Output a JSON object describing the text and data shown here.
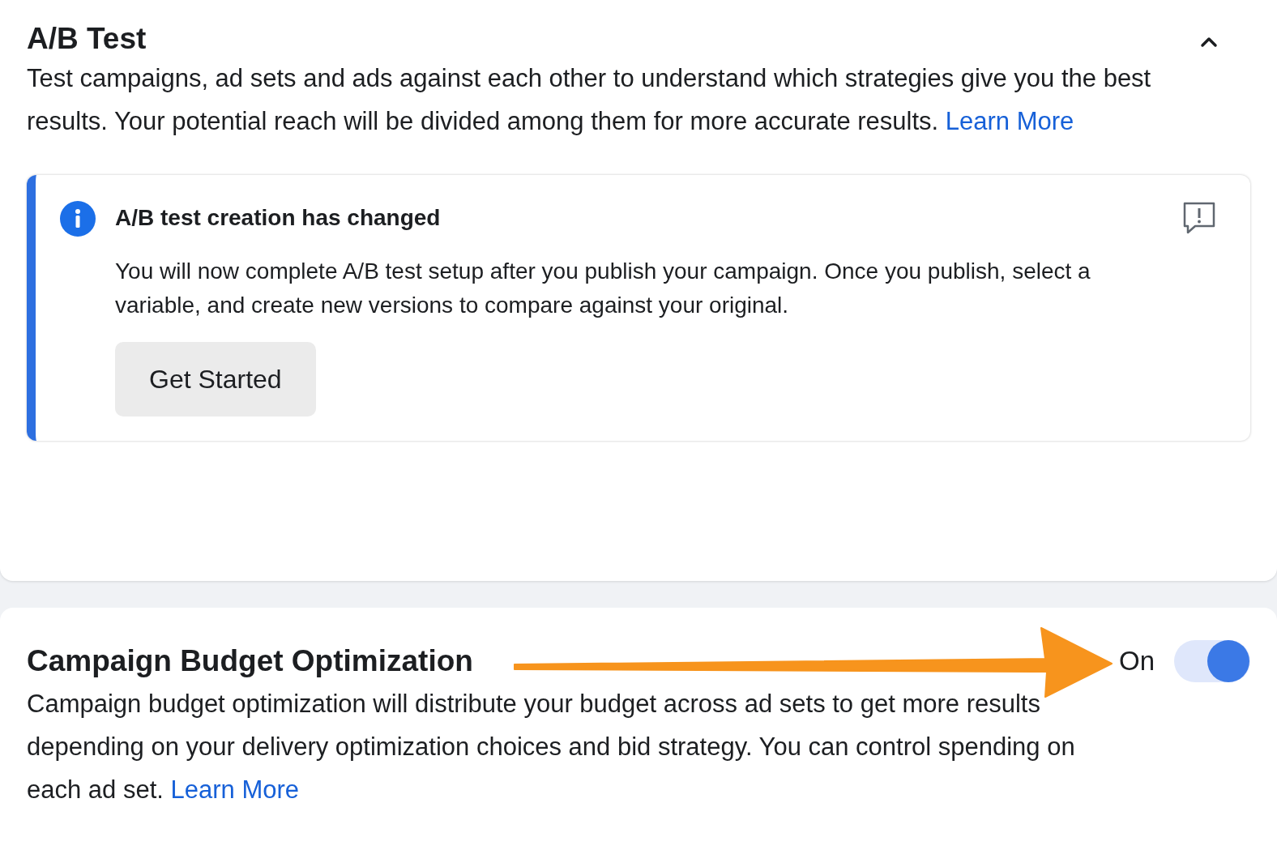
{
  "ab_test": {
    "title": "A/B Test",
    "expanded": true,
    "description": "Test campaigns, ad sets and ads against each other to understand which strategies give you the best results. Your potential reach will be divided among them for more accurate results.",
    "link": "Learn More",
    "notice": {
      "title": "A/B test creation has changed",
      "body": "You will now complete A/B test setup after you publish your campaign. Once you publish, select a variable, and create new versions to compare against your original.",
      "button": "Get Started"
    }
  },
  "campaign_budget_optimization": {
    "title": "Campaign Budget Optimization",
    "description": "Campaign budget optimization will distribute your budget across ad sets to get more results depending on your delivery optimization choices and bid strategy. You can control spending on each ad set.",
    "link": "Learn More",
    "toggle": {
      "label": "On",
      "on": true
    }
  }
}
